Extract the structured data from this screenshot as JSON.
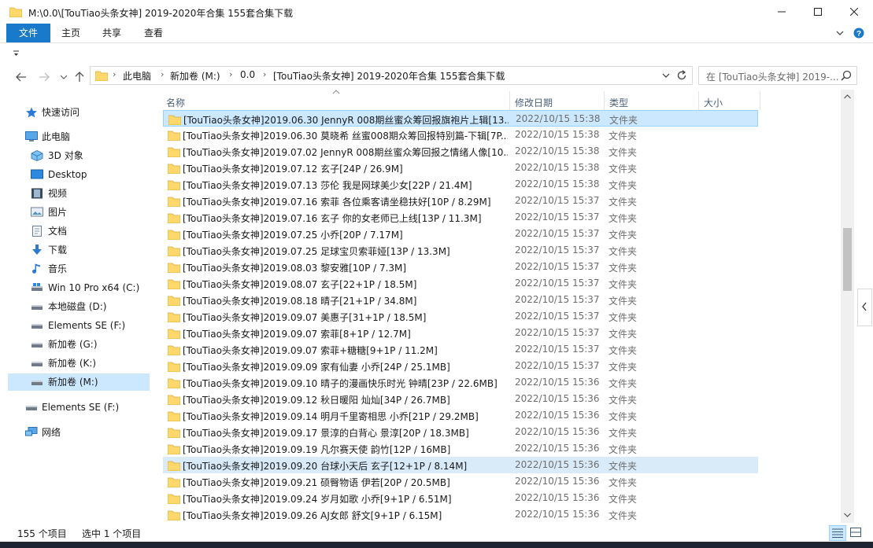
{
  "window": {
    "title": "M:\\0.0\\[TouTiao头条女神] 2019-2020年合集 155套合集下载",
    "controls": [
      "minimize",
      "maximize",
      "close"
    ]
  },
  "ribbon": {
    "tabs": [
      "文件",
      "主页",
      "共享",
      "查看"
    ]
  },
  "address": {
    "crumbs": [
      "此电脑",
      "新加卷 (M:)",
      "0.0",
      "[TouTiao头条女神] 2019-2020年合集 155套合集下载"
    ]
  },
  "search": {
    "placeholder": "在 [TouTiao头条女神] 2019-..."
  },
  "sidebar": {
    "items": [
      {
        "label": "快速访问",
        "icon": "star-icon"
      },
      {
        "label": "此电脑",
        "icon": "computer-icon"
      },
      {
        "label": "3D 对象",
        "icon": "3d-objects-icon"
      },
      {
        "label": "Desktop",
        "icon": "desktop-icon"
      },
      {
        "label": "视频",
        "icon": "video-icon"
      },
      {
        "label": "图片",
        "icon": "pictures-icon"
      },
      {
        "label": "文档",
        "icon": "documents-icon"
      },
      {
        "label": "下载",
        "icon": "download-icon"
      },
      {
        "label": "音乐",
        "icon": "music-icon"
      },
      {
        "label": "Win 10 Pro x64 (C:)",
        "icon": "drive-icon"
      },
      {
        "label": "本地磁盘 (D:)",
        "icon": "drive-icon"
      },
      {
        "label": "Elements SE (F:)",
        "icon": "drive-icon"
      },
      {
        "label": "新加卷 (G:)",
        "icon": "drive-icon"
      },
      {
        "label": "新加卷 (K:)",
        "icon": "drive-icon"
      },
      {
        "label": "新加卷 (M:)",
        "icon": "drive-icon"
      },
      {
        "label": "Elements SE (F:)",
        "icon": "drive-icon"
      },
      {
        "label": "网络",
        "icon": "network-icon"
      }
    ]
  },
  "columns": {
    "name": "名称",
    "date": "修改日期",
    "type": "类型",
    "size": "大小"
  },
  "files": [
    {
      "name": "[TouTiao头条女神]2019.06.30 JennyR 008期丝蜜众筹回报旗袍片上辑[13...",
      "date": "2022/10/15 15:38",
      "type": "文件夹"
    },
    {
      "name": "[TouTiao头条女神]2019.06.30 莫晓希 丝蜜008期众筹回报特别篇-下辑[7P...",
      "date": "2022/10/15 15:38",
      "type": "文件夹"
    },
    {
      "name": "[TouTiao头条女神]2019.07.02 JennyR 008期丝蜜众筹回报之情绪人像[10...",
      "date": "2022/10/15 15:38",
      "type": "文件夹"
    },
    {
      "name": "[TouTiao头条女神]2019.07.12 玄子[24P / 26.9M]",
      "date": "2022/10/15 15:38",
      "type": "文件夹"
    },
    {
      "name": "[TouTiao头条女神]2019.07.13 莎伦 我是网球美少女[22P / 21.4M]",
      "date": "2022/10/15 15:38",
      "type": "文件夹"
    },
    {
      "name": "[TouTiao头条女神]2019.07.16 索菲 各位乘客请坐稳扶好[10P / 8.29M]",
      "date": "2022/10/15 15:37",
      "type": "文件夹"
    },
    {
      "name": "[TouTiao头条女神]2019.07.16 玄子 你的女老师已上线[13P / 11.3M]",
      "date": "2022/10/15 15:37",
      "type": "文件夹"
    },
    {
      "name": "[TouTiao头条女神]2019.07.25 小乔[20P / 7.17M]",
      "date": "2022/10/15 15:37",
      "type": "文件夹"
    },
    {
      "name": "[TouTiao头条女神]2019.07.25 足球宝贝索菲娅[13P / 13.3M]",
      "date": "2022/10/15 15:37",
      "type": "文件夹"
    },
    {
      "name": "[TouTiao头条女神]2019.08.03 黎安雅[10P / 7.3M]",
      "date": "2022/10/15 15:37",
      "type": "文件夹"
    },
    {
      "name": "[TouTiao头条女神]2019.08.07 玄子[22+1P / 18.5M]",
      "date": "2022/10/15 15:37",
      "type": "文件夹"
    },
    {
      "name": "[TouTiao头条女神]2019.08.18 晴子[21+1P / 34.8M]",
      "date": "2022/10/15 15:37",
      "type": "文件夹"
    },
    {
      "name": "[TouTiao头条女神]2019.09.07 美惠子[31+1P / 18.5M]",
      "date": "2022/10/15 15:37",
      "type": "文件夹"
    },
    {
      "name": "[TouTiao头条女神]2019.09.07 索菲[8+1P / 12.7M]",
      "date": "2022/10/15 15:37",
      "type": "文件夹"
    },
    {
      "name": "[TouTiao头条女神]2019.09.07 索菲+糖糖[9+1P / 11.2M]",
      "date": "2022/10/15 15:37",
      "type": "文件夹"
    },
    {
      "name": "[TouTiao头条女神]2019.09.09 家有仙妻 小乔[24P / 25.1MB]",
      "date": "2022/10/15 15:37",
      "type": "文件夹"
    },
    {
      "name": "[TouTiao头条女神]2019.09.10 晴子的漫画快乐时光 钟晴[23P / 22.6MB]",
      "date": "2022/10/15 15:36",
      "type": "文件夹"
    },
    {
      "name": "[TouTiao头条女神]2019.09.12 秋日暖阳 灿灿[34P / 26.7MB]",
      "date": "2022/10/15 15:36",
      "type": "文件夹"
    },
    {
      "name": "[TouTiao头条女神]2019.09.14 明月千里寄相思 小乔[21P / 29.2MB]",
      "date": "2022/10/15 15:36",
      "type": "文件夹"
    },
    {
      "name": "[TouTiao头条女神]2019.09.17 景淳的白背心 景淳[20P / 18.3MB]",
      "date": "2022/10/15 15:36",
      "type": "文件夹"
    },
    {
      "name": "[TouTiao头条女神]2019.09.19 凡尔赛天使 韵竹[12P / 16MB]",
      "date": "2022/10/15 15:36",
      "type": "文件夹"
    },
    {
      "name": "[TouTiao头条女神]2019.09.20 台球小天后 玄子[12+1P / 8.14M]",
      "date": "2022/10/15 15:36",
      "type": "文件夹"
    },
    {
      "name": "[TouTiao头条女神]2019.09.21 硕臀物语 伊若[20P / 20.5MB]",
      "date": "2022/10/15 15:36",
      "type": "文件夹"
    },
    {
      "name": "[TouTiao头条女神]2019.09.24 岁月如歌 小乔[9+1P / 6.51M]",
      "date": "2022/10/15 15:36",
      "type": "文件夹"
    },
    {
      "name": "[TouTiao头条女神]2019.09.26 AJ女郎 舒文[9+1P / 6.15M]",
      "date": "2022/10/15 15:36",
      "type": "文件夹"
    }
  ],
  "status": {
    "count": "155 个项目",
    "selected": "选中 1 个项目"
  },
  "colors": {
    "accent": "#1979ca",
    "folder": "#ffd86b",
    "selected": "#cce8ff"
  }
}
